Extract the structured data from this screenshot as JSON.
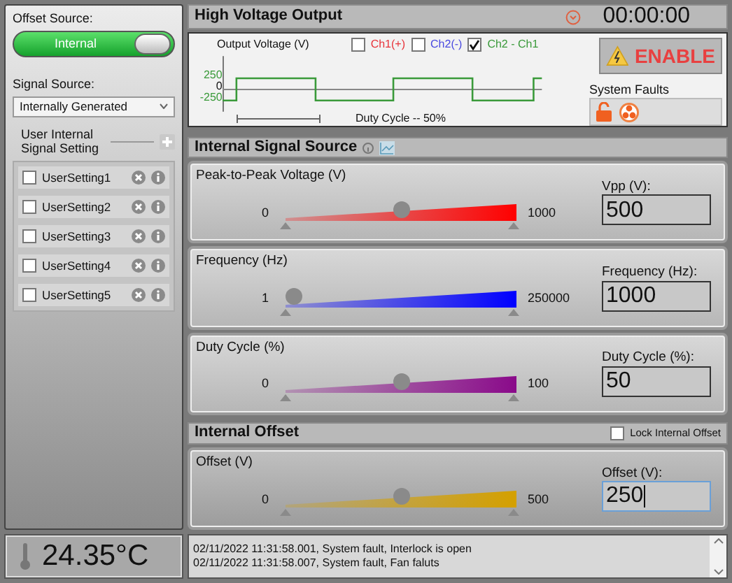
{
  "offset_source": {
    "label": "Offset Source:",
    "toggle_text": "Internal",
    "on": true
  },
  "signal_source": {
    "label": "Signal Source:",
    "value": "Internally Generated"
  },
  "user_settings": {
    "label": "User Internal Signal Setting",
    "items": [
      {
        "name": "UserSetting1",
        "checked": false
      },
      {
        "name": "UserSetting2",
        "checked": false
      },
      {
        "name": "UserSetting3",
        "checked": false
      },
      {
        "name": "UserSetting4",
        "checked": false
      },
      {
        "name": "UserSetting5",
        "checked": false
      }
    ]
  },
  "temperature": "24.35°C",
  "output": {
    "title": "High Voltage Output",
    "timer": "00:00:00",
    "chart_label": "Output Voltage (V)",
    "channels": [
      {
        "label": "Ch1(+)",
        "checked": false,
        "color": "#e8333a"
      },
      {
        "label": "Ch2(-)",
        "checked": false,
        "color": "#4a4ae0"
      },
      {
        "label": "Ch2 - Ch1",
        "checked": true,
        "color": "#3a9a3a"
      }
    ],
    "yticks": [
      "250",
      "0",
      "-250"
    ],
    "duty_label": "Duty Cycle -- 50%",
    "enable_button": "ENABLE",
    "faults_label": "System Faults"
  },
  "signal_section": {
    "title": "Internal Signal Source",
    "sliders": [
      {
        "title": "Peak-to-Peak Voltage (V)",
        "min": "0",
        "max": "1000",
        "level": 0.5,
        "color": "#ff0000",
        "field_label": "Vpp (V):",
        "value": "500",
        "focused": false
      },
      {
        "title": "Frequency (Hz)",
        "min": "1",
        "max": "250000",
        "level": 0,
        "color": "#0000ff",
        "field_label": "Frequency (Hz):",
        "value": "1000",
        "focused": false
      },
      {
        "title": "Duty Cycle (%)",
        "min": "0",
        "max": "100",
        "level": 0.5,
        "color": "#8a0a8a",
        "field_label": "Duty Cycle (%):",
        "value": "50",
        "focused": false
      }
    ]
  },
  "offset_section": {
    "title": "Internal Offset",
    "lock_label": "Lock Internal Offset",
    "lock_checked": false,
    "slider": {
      "title": "Offset (V)",
      "min": "0",
      "max": "500",
      "level": 0.5,
      "color": "#d4a000",
      "field_label": "Offset (V):",
      "value": "250",
      "focused": true
    }
  },
  "log": [
    "02/11/2022 11:31:58.001, System fault, Interlock is open",
    "02/11/2022 11:31:58.007, System fault, Fan faluts"
  ]
}
